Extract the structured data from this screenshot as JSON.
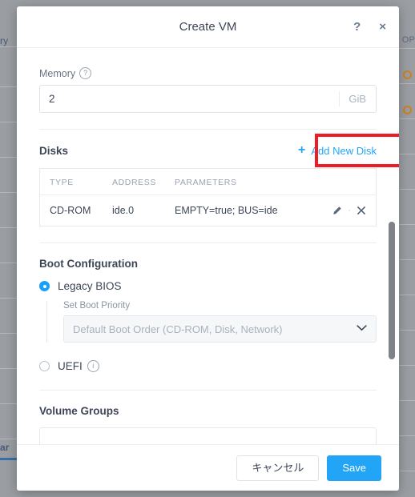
{
  "modal": {
    "title": "Create VM",
    "header_icons": {
      "help": "?",
      "close": "×"
    },
    "memory": {
      "label": "Memory",
      "info_glyph": "?",
      "value": "2",
      "placeholder": "",
      "unit": "GiB"
    },
    "disks": {
      "title": "Disks",
      "add_label": "Add New Disk",
      "add_plus": "+",
      "columns": [
        "TYPE",
        "ADDRESS",
        "PARAMETERS"
      ],
      "rows": [
        {
          "type": "CD-ROM",
          "address": "ide.0",
          "parameters": "EMPTY=true; BUS=ide",
          "edit_icon": "pencil-icon",
          "separator": "·",
          "delete_icon": "×"
        }
      ]
    },
    "boot": {
      "title": "Boot Configuration",
      "legacy": {
        "label": "Legacy BIOS",
        "selected": true
      },
      "boot_priority": {
        "label": "Set Boot Priority",
        "selected": "Default Boot Order (CD-ROM, Disk, Network)",
        "chevron": "⌄",
        "disabled": true
      },
      "uefi": {
        "label": "UEFI",
        "info_glyph": "i",
        "selected": false
      }
    },
    "volume_groups": {
      "title": "Volume Groups"
    },
    "footer": {
      "cancel_label": "キャンセル",
      "save_label": "Save"
    }
  },
  "highlight": {
    "color": "#ee1c25",
    "target": "Add New Disk"
  },
  "background": {
    "left_text": "ry",
    "left_tab_text": "ar",
    "right_text": "OP"
  },
  "colors": {
    "accent": "#22a5f7",
    "radio_selected": "#18a0fb",
    "highlight": "#ee1c25",
    "text": "#3d4657",
    "muted": "#9aa3b1",
    "backdrop": "#9a9ea3"
  }
}
